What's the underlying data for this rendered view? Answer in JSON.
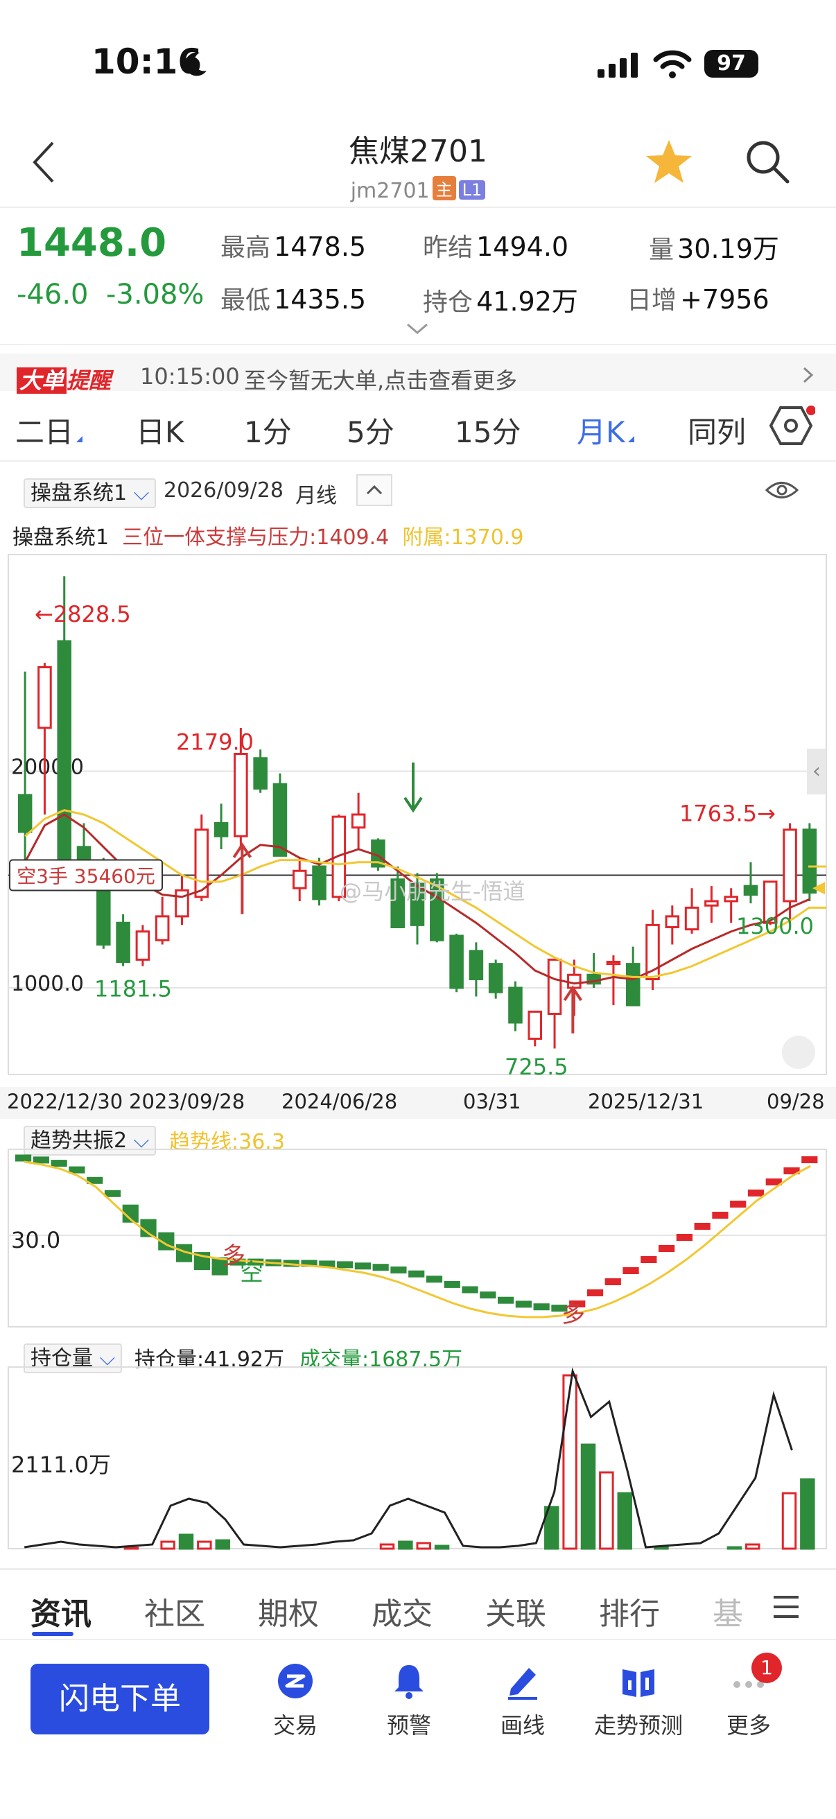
{
  "status": {
    "time": "10:16",
    "battery": "97"
  },
  "header": {
    "title": "焦煤2701",
    "symbol": "jm2701",
    "tag_main": "主",
    "tag_level": "L1"
  },
  "quote": {
    "price": "1448.0",
    "change": "-46.0",
    "change_pct": "-3.08%",
    "high_label": "最高",
    "high": "1478.5",
    "low_label": "最低",
    "low": "1435.5",
    "prev_label": "昨结",
    "prev": "1494.0",
    "oi_label": "持仓",
    "oi": "41.92万",
    "vol_label": "量",
    "vol": "30.19万",
    "daily_label": "日增",
    "daily": "+7956"
  },
  "alert": {
    "badge_a": "大单",
    "badge_b": "提醒",
    "time": "10:15:00",
    "text": "至今暂无大单,点击查看更多"
  },
  "period_tabs": [
    "二日",
    "日K",
    "1分",
    "5分",
    "15分",
    "月K",
    "同列"
  ],
  "main_chart": {
    "system_select": "操盘系统1",
    "date": "2026/09/28",
    "freq": "月线",
    "legend_name": "操盘系统1",
    "legend_support": "三位一体支撑与压力:1409.4",
    "legend_aux": "附属:1370.9",
    "position_box": "空3手 35460元",
    "watermark": "@马小朋先生-悟道"
  },
  "chart_data": {
    "type": "candlestick",
    "period": "monthly",
    "x_tick_labels": [
      "2022/12/30",
      "2023/09/28",
      "2024/06/28",
      "03/31",
      "2025/12/31",
      "09/28"
    ],
    "y_tick_labels": [
      "2000.0",
      "1000.0"
    ],
    "y_range": [
      600,
      3000
    ],
    "annotations": [
      "←2828.5",
      "2179.0",
      "1181.5",
      "725.5",
      "1763.5→",
      "1300.0"
    ],
    "candles": [
      [
        1890,
        2460,
        1490,
        1720
      ],
      [
        2200,
        2500,
        1800,
        2480
      ],
      [
        2600,
        2900,
        1500,
        1550
      ],
      [
        1650,
        1760,
        1520,
        1560
      ],
      [
        1560,
        1600,
        1180,
        1200
      ],
      [
        1300,
        1340,
        1100,
        1120
      ],
      [
        1130,
        1290,
        1100,
        1260
      ],
      [
        1220,
        1420,
        1200,
        1330
      ],
      [
        1330,
        1520,
        1290,
        1450
      ],
      [
        1420,
        1800,
        1400,
        1730
      ],
      [
        1760,
        1850,
        1640,
        1700
      ],
      [
        1700,
        2200,
        1650,
        2080
      ],
      [
        2060,
        2100,
        1900,
        1920
      ],
      [
        1940,
        1990,
        1650,
        1610
      ],
      [
        1460,
        1600,
        1400,
        1540
      ],
      [
        1560,
        1600,
        1380,
        1410
      ],
      [
        1420,
        1800,
        1400,
        1790
      ],
      [
        1740,
        1900,
        1640,
        1800
      ],
      [
        1680,
        1690,
        1540,
        1560
      ],
      [
        1500,
        1560,
        1310,
        1280
      ],
      [
        1480,
        1530,
        1200,
        1290
      ],
      [
        1500,
        1530,
        1210,
        1220
      ],
      [
        1240,
        1250,
        980,
        1000
      ],
      [
        1170,
        1210,
        960,
        1040
      ],
      [
        1110,
        1130,
        950,
        980
      ],
      [
        1000,
        1030,
        800,
        840
      ],
      [
        765,
        880,
        730,
        890
      ],
      [
        880,
        1080,
        720,
        1130
      ],
      [
        1000,
        1130,
        870,
        1060
      ],
      [
        1060,
        1160,
        1000,
        1020
      ],
      [
        1110,
        1150,
        920,
        1120
      ],
      [
        1110,
        1190,
        930,
        920
      ],
      [
        1040,
        1360,
        990,
        1290
      ],
      [
        1280,
        1380,
        1200,
        1330
      ],
      [
        1270,
        1460,
        1250,
        1370
      ],
      [
        1380,
        1470,
        1300,
        1400
      ],
      [
        1400,
        1460,
        1300,
        1420
      ],
      [
        1470,
        1580,
        1390,
        1430
      ],
      [
        1300,
        1480,
        1290,
        1490
      ],
      [
        1400,
        1760,
        1300,
        1730
      ],
      [
        1730,
        1760,
        1400,
        1440
      ]
    ],
    "series": [
      {
        "name": "三位一体支撑与压力",
        "values": [
          1580,
          1750,
          1800,
          1740,
          1650,
          1560,
          1480,
          1430,
          1420,
          1450,
          1520,
          1600,
          1660,
          1650,
          1600,
          1570,
          1610,
          1640,
          1610,
          1540,
          1470,
          1420,
          1360,
          1300,
          1230,
          1160,
          1080,
          1040,
          1020,
          1030,
          1050,
          1040,
          1080,
          1130,
          1180,
          1220,
          1260,
          1290,
          1310,
          1370,
          1409
        ]
      },
      {
        "name": "附属",
        "values": [
          1700,
          1780,
          1820,
          1800,
          1760,
          1700,
          1640,
          1580,
          1520,
          1490,
          1490,
          1520,
          1560,
          1590,
          1590,
          1580,
          1570,
          1580,
          1580,
          1550,
          1510,
          1470,
          1420,
          1370,
          1310,
          1250,
          1190,
          1140,
          1100,
          1070,
          1060,
          1050,
          1050,
          1070,
          1100,
          1140,
          1180,
          1220,
          1260,
          1310,
          1371
        ]
      }
    ]
  },
  "trend_chart": {
    "select": "趋势共振2",
    "legend": "趋势线:36.3",
    "y_tick_label": "30.0",
    "marks": [
      "多",
      "空",
      "多"
    ]
  },
  "volume_chart": {
    "select": "持仓量",
    "legend_oi": "持仓量:41.92万",
    "legend_vol": "成交量:1687.5万",
    "y_tick_label": "2111.0万"
  },
  "bottom_tabs": [
    "资讯",
    "社区",
    "期权",
    "成交",
    "关联",
    "排行",
    "基"
  ],
  "bottom_bar": {
    "flash_order": "闪电下单",
    "items": [
      "交易",
      "预警",
      "画线",
      "走势预测",
      "更多"
    ],
    "badge": "1"
  }
}
